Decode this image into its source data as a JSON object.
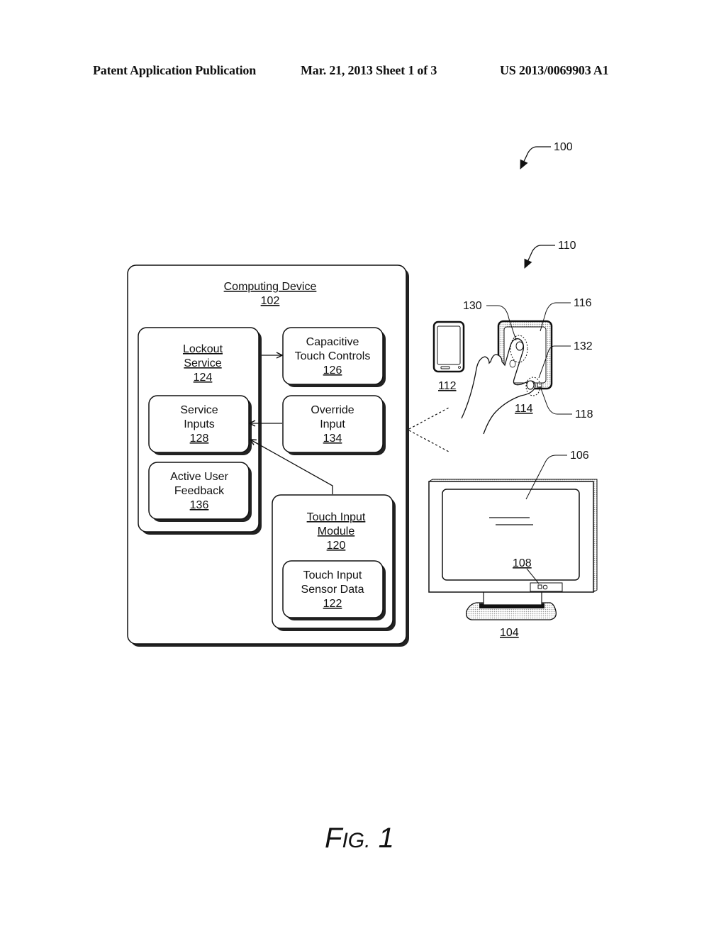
{
  "header": {
    "left": "Patent Application Publication",
    "center": "Mar. 21, 2013  Sheet 1 of 3",
    "right": "US 2013/0069903 A1"
  },
  "figure": {
    "label_prefix": "F",
    "label_small": "IG.",
    "label_number": "1",
    "ref_overall": "100",
    "ref_device_group": "110"
  },
  "computing_device": {
    "title": "Computing Device",
    "ref": "102",
    "lockout_service": {
      "line1": "Lockout",
      "line2": "Service",
      "ref": "124"
    },
    "service_inputs": {
      "line1": "Service",
      "line2": "Inputs",
      "ref": "128"
    },
    "active_user_feedback": {
      "line1": "Active User",
      "line2": "Feedback",
      "ref": "136"
    },
    "capacitive_touch_controls": {
      "line1": "Capacitive",
      "line2": "Touch Controls",
      "ref": "126"
    },
    "override_input": {
      "line1": "Override",
      "line2": "Input",
      "ref": "134"
    },
    "touch_input_module": {
      "line1": "Touch Input",
      "line2": "Module",
      "ref": "120"
    },
    "touch_input_sensor_data": {
      "line1": "Touch Input",
      "line2": "Sensor Data",
      "ref": "122"
    }
  },
  "devices": {
    "phone_ref": "112",
    "tablet_ref": "114",
    "tablet_screen_ref": "116",
    "button_ref": "118",
    "touch_region_ref": "130",
    "edge_touch_ref": "132",
    "monitor_ref": "104",
    "monitor_screen_ref": "106",
    "monitor_sensor_ref": "108"
  }
}
